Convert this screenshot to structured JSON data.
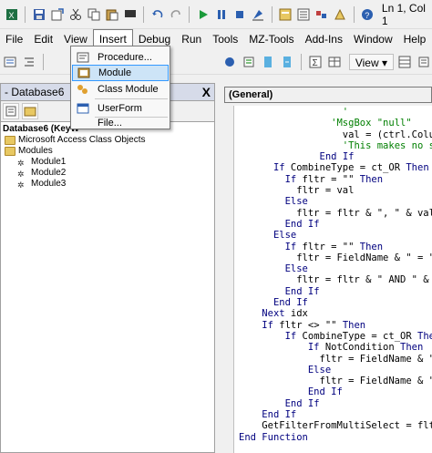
{
  "toolbar": {
    "cursor_position": "Ln 1, Col 1",
    "icons": [
      "excel-icon",
      "save-icon",
      "insert-icon",
      "cut-icon",
      "copy-icon",
      "paste-icon",
      "find-icon",
      "undo-icon",
      "redo-icon",
      "run-icon",
      "break-icon",
      "reset-icon",
      "design-mode-icon",
      "project-explorer-icon",
      "properties-icon",
      "object-browser-icon",
      "toolbox-icon",
      "help-icon"
    ]
  },
  "menubar": {
    "items": [
      "File",
      "Edit",
      "View",
      "Insert",
      "Debug",
      "Run",
      "Tools",
      "MZ-Tools",
      "Add-Ins",
      "Window",
      "Help"
    ],
    "active": "Insert"
  },
  "insert_menu": {
    "items": [
      {
        "label": "Procedure...",
        "icon": "procedure-icon"
      },
      {
        "label": "Module",
        "icon": "module-icon"
      },
      {
        "label": "Class Module",
        "icon": "class-module-icon"
      },
      {
        "label": "UserForm",
        "icon": "userform-icon"
      },
      {
        "label": "File...",
        "icon": "file-icon"
      }
    ],
    "selected": "Module"
  },
  "toolbar2": {
    "view_label": "View"
  },
  "project_explorer": {
    "title": "- Database6",
    "close": "X",
    "tree": [
      {
        "label": "Database6 (KeyW",
        "level": 0,
        "icon": "project-icon",
        "bold": true
      },
      {
        "label": "Microsoft Access Class Objects",
        "level": 1,
        "icon": "folder-icon"
      },
      {
        "label": "Modules",
        "level": 1,
        "icon": "folder-icon"
      },
      {
        "label": "Module1",
        "level": 2,
        "icon": "module-icon"
      },
      {
        "label": "Module2",
        "level": 2,
        "icon": "module-icon"
      },
      {
        "label": "Module3",
        "level": 2,
        "icon": "module-icon"
      }
    ]
  },
  "code_window": {
    "object_dropdown": "(General)",
    "lines": [
      {
        "indent": 9,
        "text": "'",
        "type": "comment"
      },
      {
        "indent": 8,
        "text": "'MsgBox \"null\"",
        "type": "comment"
      },
      {
        "indent": 9,
        "text": "val = (ctrl.Column(theC",
        "type": "code"
      },
      {
        "indent": 9,
        "text": "'This makes no sense,",
        "type": "comment"
      },
      {
        "indent": 7,
        "text": "End If",
        "type": "keyword"
      },
      {
        "indent": 3,
        "text": "If CombineType = ct_OR Then",
        "type": "keyword"
      },
      {
        "indent": 4,
        "text": "If fltr = \"\" Then",
        "type": "keyword"
      },
      {
        "indent": 5,
        "text": "fltr = val",
        "type": "code"
      },
      {
        "indent": 4,
        "text": "Else",
        "type": "keyword"
      },
      {
        "indent": 5,
        "text": "fltr = fltr & \", \" & val",
        "type": "code"
      },
      {
        "indent": 4,
        "text": "End If",
        "type": "keyword"
      },
      {
        "indent": 3,
        "text": "Else",
        "type": "keyword"
      },
      {
        "indent": 4,
        "text": "If fltr = \"\" Then",
        "type": "keyword"
      },
      {
        "indent": 5,
        "text": "fltr = FieldName & \" = \" & v",
        "type": "code"
      },
      {
        "indent": 4,
        "text": "Else",
        "type": "keyword"
      },
      {
        "indent": 5,
        "text": "fltr = fltr & \" AND \" & Fie",
        "type": "code"
      },
      {
        "indent": 4,
        "text": "End If",
        "type": "keyword"
      },
      {
        "indent": 3,
        "text": "End If",
        "type": "keyword"
      },
      {
        "indent": 2,
        "text": "Next idx",
        "type": "keyword"
      },
      {
        "indent": 2,
        "text": "If fltr <> \"\" Then",
        "type": "keyword"
      },
      {
        "indent": 4,
        "text": "If CombineType = ct_OR Then",
        "type": "keyword"
      },
      {
        "indent": 6,
        "text": "If NotCondition Then",
        "type": "keyword"
      },
      {
        "indent": 7,
        "text": "fltr = FieldName & \" NOT",
        "type": "code"
      },
      {
        "indent": 6,
        "text": "Else",
        "type": "keyword"
      },
      {
        "indent": 7,
        "text": "fltr = FieldName & \" IN",
        "type": "code"
      },
      {
        "indent": 6,
        "text": "End If",
        "type": "keyword"
      },
      {
        "indent": 4,
        "text": "End If",
        "type": "keyword"
      },
      {
        "indent": 2,
        "text": "End If",
        "type": "keyword"
      },
      {
        "indent": 2,
        "text": "GetFilterFromMultiSelect = fltr",
        "type": "code"
      },
      {
        "indent": 0,
        "text": "End Function",
        "type": "keyword"
      }
    ]
  },
  "colors": {
    "keyword": "#00007f",
    "comment": "#007f00",
    "selection_bg": "#cde4f7",
    "selection_border": "#3399ff"
  }
}
